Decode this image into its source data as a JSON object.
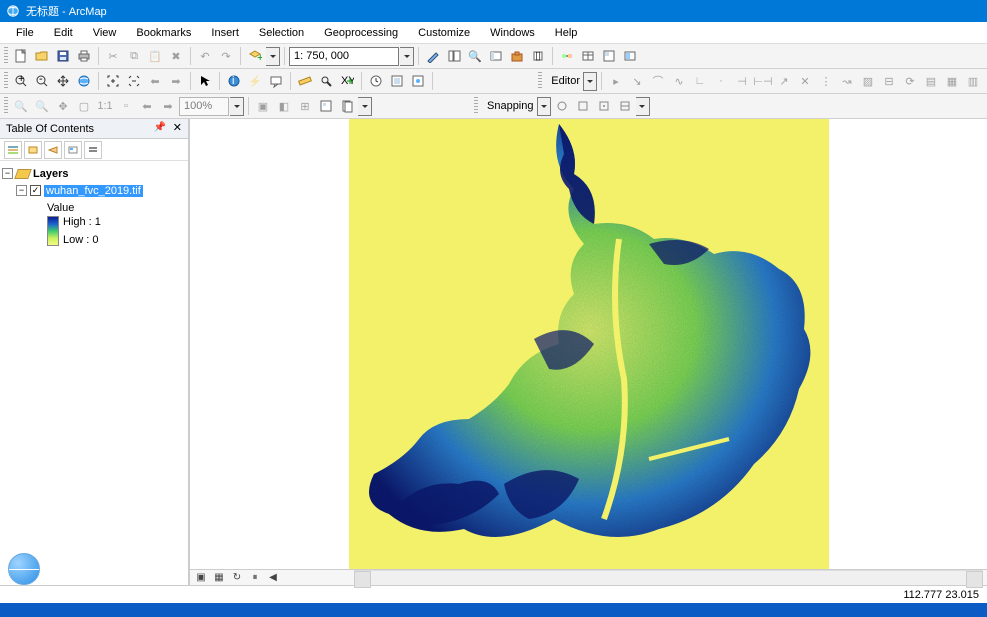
{
  "title": "无标题 - ArcMap",
  "menu": [
    "File",
    "Edit",
    "View",
    "Bookmarks",
    "Insert",
    "Selection",
    "Geoprocessing",
    "Customize",
    "Windows",
    "Help"
  ],
  "scale": "1: 750, 000",
  "zoom": "100%",
  "snapping_label": "Snapping",
  "editor_label": "Editor",
  "toc_title": "Table Of Contents",
  "layers_root": "Layers",
  "layer_name": "wuhan_fvc_2019.tif",
  "value_label": "Value",
  "legend_high": "High : 1",
  "legend_low": "Low : 0",
  "status_coords": "112.777   23.015",
  "footer_controls": [
    "▣",
    "▦",
    "↻",
    "⏸",
    "◀"
  ]
}
